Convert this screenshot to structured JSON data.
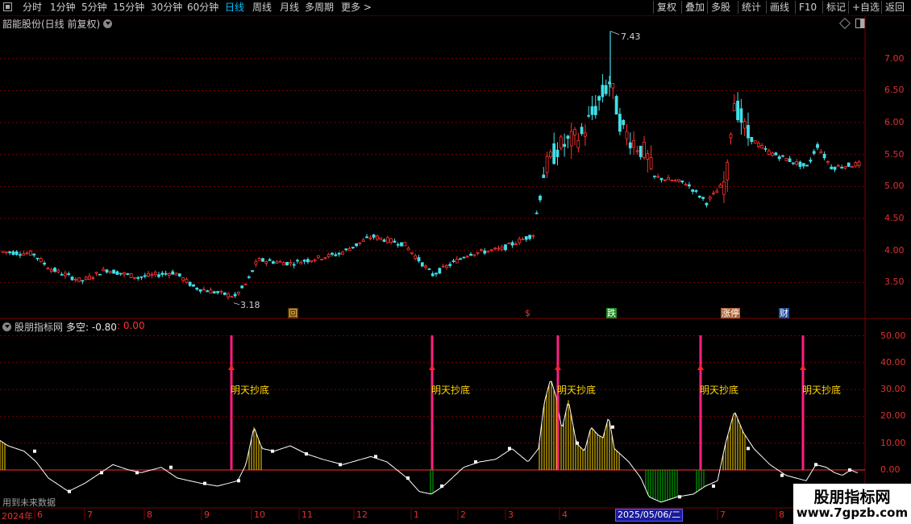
{
  "toolbar": {
    "periods": [
      "分时",
      "1分钟",
      "5分钟",
      "15分钟",
      "30分钟",
      "60分钟",
      "日线",
      "周线",
      "月线",
      "多周期",
      "更多 >"
    ],
    "active": "日线",
    "buttons": [
      "复权",
      "叠加",
      "多股",
      "统计",
      "画线",
      "F10",
      "标记",
      "+自选",
      "返回"
    ]
  },
  "main_title": "韶能股份(日线 前复权)",
  "price_axis": [
    "7.00",
    "6.50",
    "6.00",
    "5.50",
    "5.00",
    "4.50",
    "4.00",
    "3.50"
  ],
  "high_label": "7.43",
  "low_label": "3.18",
  "events": [
    {
      "label": "回",
      "color": "#ffcc66",
      "bg": "#5a3a00"
    },
    {
      "label": "$",
      "color": "#ff3030",
      "bg": "transparent"
    },
    {
      "label": "跌",
      "color": "#ffffff",
      "bg": "#1f8a1f"
    },
    {
      "label": "涨停",
      "color": "#ffffff",
      "bg": "#b06030"
    },
    {
      "label": "财",
      "color": "#ffffff",
      "bg": "#204a9a"
    }
  ],
  "indicator": {
    "name": "股朋指标网",
    "series_label": "多空: -0.80",
    "series_label2": ": 0.00",
    "axis": [
      "50.00",
      "40.00",
      "30.00",
      "20.00",
      "10.00",
      "0.00"
    ],
    "signal_text": "明天抄底",
    "footer_note": "用到未来数据"
  },
  "x_axis": {
    "year": "2024年",
    "months": [
      "6",
      "7",
      "8",
      "9",
      "10",
      "11",
      "12",
      "1",
      "2",
      "3",
      "4",
      "5",
      "6",
      "7",
      "8"
    ],
    "cursor_date": "2025/05/06/二"
  },
  "watermark": {
    "title": "股朋指标网",
    "url": "www.7gpzb.com"
  },
  "colors": {
    "up": "#ff3232",
    "down": "#40e0e8",
    "grid": "#7a0000",
    "signal": "#ff1e82",
    "gold": "#ffd700",
    "green": "#00c000"
  }
}
